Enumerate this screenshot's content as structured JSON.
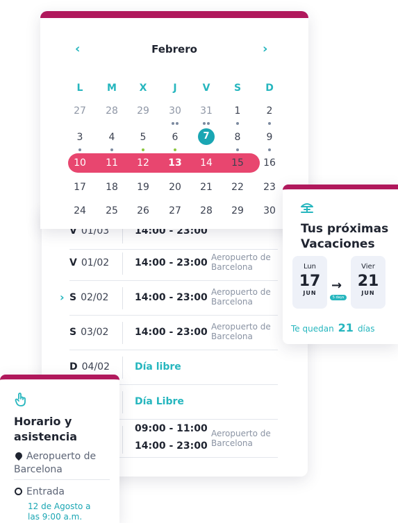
{
  "calendar": {
    "month": "Febrero",
    "prev_icon": "chevron-left-icon",
    "next_icon": "chevron-right-icon",
    "weekdays": [
      "L",
      "M",
      "X",
      "J",
      "V",
      "S",
      "D"
    ],
    "rows": [
      [
        "27",
        "28",
        "29",
        "30",
        "31",
        "1",
        "2"
      ],
      [
        "3",
        "4",
        "5",
        "6",
        "7",
        "8",
        "9"
      ],
      [
        "10",
        "11",
        "12",
        "13",
        "14",
        "15",
        "16"
      ],
      [
        "17",
        "18",
        "19",
        "20",
        "21",
        "22",
        "23"
      ],
      [
        "24",
        "25",
        "26",
        "27",
        "28",
        "29",
        "30"
      ]
    ],
    "today": "7",
    "selected_week_color": "#e8466f",
    "today_color": "#1aa6b3"
  },
  "schedule": {
    "rows": [
      {
        "day_letter": "V",
        "date": "01/02",
        "time": "14:00 - 23:00",
        "place": "Aeropuerto de Barcelona"
      },
      {
        "day_letter": "S",
        "date": "02/02",
        "time": "14:00 - 23:00",
        "place": "Aeropuerto de Barcelona"
      },
      {
        "day_letter": "S",
        "date": "03/02",
        "time": "14:00 - 23:00",
        "place": "Aeropuerto de Barcelona"
      },
      {
        "day_letter": "D",
        "date": "04/02",
        "free": "Día libre"
      },
      {
        "free": "Día Libre"
      },
      {
        "time": "09:00 - 11:00",
        "time2": "14:00 - 23:00",
        "place": "Aeropuerto de Barcelona"
      }
    ],
    "hidden_row": {
      "day_letter": "V",
      "date": "01/03",
      "time": "14:00 - 23:00"
    }
  },
  "vacation": {
    "icon": "umbrella-beach-icon",
    "title_line1": "Tus próximas",
    "title_line2": "Vacaciones",
    "start": {
      "day_name": "Lun",
      "day": "17",
      "month": "JUN"
    },
    "end": {
      "day_name": "Vier",
      "day": "21",
      "month": "JUN"
    },
    "duration": "5 days",
    "remaining_prefix": "Te quedan",
    "remaining_count": "21",
    "remaining_suffix": "días"
  },
  "attendance": {
    "icon": "hand-pointer-icon",
    "title_line1": "Horario y",
    "title_line2": "asistencia",
    "location": "Aeropuerto de Barcelona",
    "entry_label": "Entrada",
    "entry_when": "12 de Agosto a las 9:00 a.m."
  },
  "colors": {
    "brand": "#b0185c",
    "accent": "#26b6be"
  }
}
